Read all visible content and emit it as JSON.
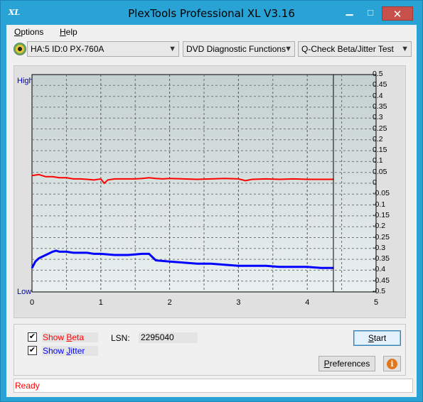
{
  "window": {
    "title": "PlexTools Professional XL V3.16",
    "icon_text": "XL"
  },
  "menu": {
    "items": [
      {
        "label": "Options"
      },
      {
        "label": "Help"
      }
    ]
  },
  "toolbar": {
    "drive": "HA:5 ID:0  PX-760A",
    "function": "DVD Diagnostic Functions",
    "test": "Q-Check Beta/Jitter Test"
  },
  "chart_data": {
    "type": "line",
    "high_label": "High",
    "low_label": "Low",
    "xlabel": "",
    "ylabel": "",
    "xlim": [
      0,
      5
    ],
    "ylim": [
      -0.5,
      0.5
    ],
    "x_ticks": [
      "0",
      "1",
      "2",
      "3",
      "4",
      "5"
    ],
    "y_ticks": [
      "0.5",
      "0.45",
      "0.4",
      "0.35",
      "0.3",
      "0.25",
      "0.2",
      "0.15",
      "0.1",
      "0.05",
      "0",
      "-0.05",
      "-0.1",
      "-0.15",
      "-0.2",
      "-0.25",
      "-0.3",
      "-0.35",
      "-0.4",
      "-0.45",
      "-0.5"
    ],
    "end_marker_x": 4.38,
    "colors": {
      "beta": "#ff0000",
      "jitter": "#0000ff",
      "plot_bg_top": "#c6d2d0",
      "plot_bg_bottom": "#e8eeee"
    },
    "series": [
      {
        "key": "beta",
        "x": [
          0,
          0.1,
          0.2,
          0.3,
          0.4,
          0.5,
          0.6,
          0.7,
          0.8,
          0.9,
          1.0,
          1.05,
          1.1,
          1.2,
          1.3,
          1.4,
          1.5,
          1.6,
          1.7,
          1.8,
          1.9,
          2.0,
          2.2,
          2.4,
          2.6,
          2.8,
          3.0,
          3.1,
          3.2,
          3.4,
          3.6,
          3.8,
          4.0,
          4.2,
          4.38
        ],
        "values": [
          0.035,
          0.04,
          0.03,
          0.03,
          0.025,
          0.025,
          0.02,
          0.02,
          0.018,
          0.015,
          0.02,
          0.0,
          0.015,
          0.02,
          0.02,
          0.02,
          0.02,
          0.022,
          0.025,
          0.022,
          0.02,
          0.022,
          0.02,
          0.018,
          0.02,
          0.022,
          0.02,
          0.012,
          0.018,
          0.02,
          0.018,
          0.02,
          0.018,
          0.018,
          0.018
        ]
      },
      {
        "key": "jitter",
        "x": [
          0,
          0.05,
          0.1,
          0.2,
          0.3,
          0.35,
          0.4,
          0.5,
          0.6,
          0.7,
          0.8,
          0.9,
          1.0,
          1.2,
          1.4,
          1.6,
          1.7,
          1.8,
          2.0,
          2.2,
          2.4,
          2.6,
          2.8,
          3.0,
          3.2,
          3.4,
          3.6,
          3.8,
          4.0,
          4.2,
          4.38
        ],
        "values": [
          -0.39,
          -0.36,
          -0.345,
          -0.33,
          -0.315,
          -0.31,
          -0.315,
          -0.315,
          -0.32,
          -0.32,
          -0.32,
          -0.325,
          -0.325,
          -0.33,
          -0.33,
          -0.325,
          -0.325,
          -0.355,
          -0.36,
          -0.365,
          -0.37,
          -0.37,
          -0.375,
          -0.38,
          -0.38,
          -0.38,
          -0.385,
          -0.385,
          -0.385,
          -0.39,
          -0.39
        ]
      }
    ]
  },
  "controls": {
    "show_beta_label": "Show Beta",
    "show_beta_prefix": "Show ",
    "show_beta_ul": "B",
    "show_beta_rest": "eta",
    "show_jitter_prefix": "Show ",
    "show_jitter_ul": "J",
    "show_jitter_rest": "itter",
    "show_beta_checked": true,
    "show_jitter_checked": true,
    "lsn_label": "LSN:",
    "lsn_value": "2295040",
    "start_ul": "S",
    "start_rest": "tart",
    "prefs_ul": "P",
    "prefs_rest": "references",
    "beta_color": "#ff0000",
    "jitter_color": "#0000ff"
  },
  "status": {
    "text": "Ready",
    "color": "#ff0000"
  }
}
